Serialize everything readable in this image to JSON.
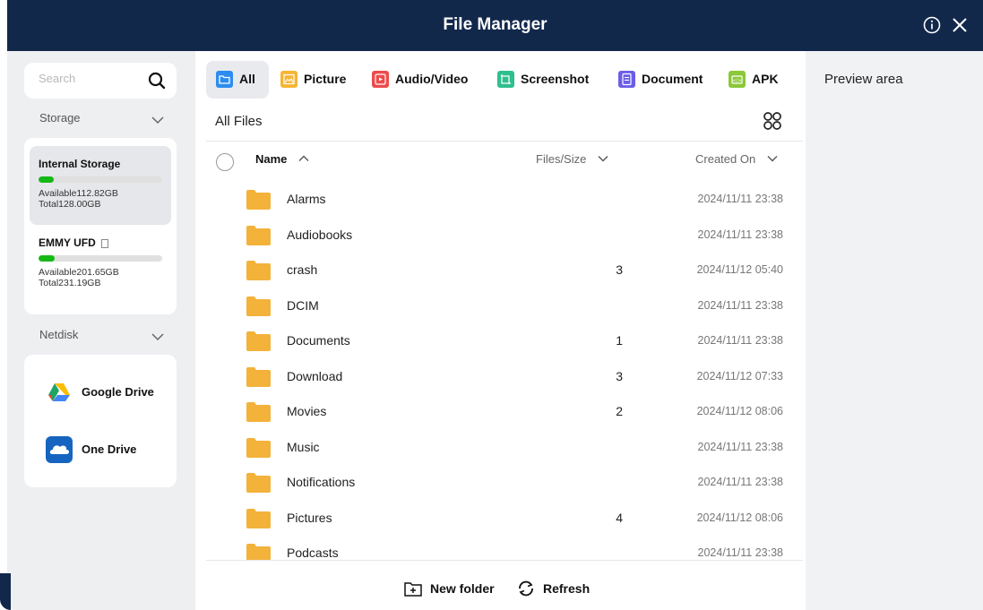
{
  "window": {
    "title": "File Manager",
    "info_icon": "info-icon",
    "close_icon": "close-icon"
  },
  "sidebar": {
    "search": {
      "placeholder": "Search",
      "value": "",
      "icon": "search-icon"
    },
    "storage_label": "Storage",
    "storage_items": [
      {
        "name": "Internal Storage",
        "available": "Available112.82GB",
        "total": "Total128.00GB",
        "used_fraction": 0.12,
        "selected": true
      },
      {
        "name": "EMMY UFD",
        "available": "Available201.65GB",
        "total": "Total231.19GB",
        "used_fraction": 0.13,
        "selected": false
      }
    ],
    "netdisk_label": "Netdisk",
    "netdisk_items": [
      {
        "label": "Google Drive",
        "icon": "google-drive-icon"
      },
      {
        "label": "One Drive",
        "icon": "onedrive-icon"
      }
    ]
  },
  "tabs": [
    {
      "label": "All",
      "icon": "folder-tab-icon",
      "color": "#2d8cf0",
      "active": true
    },
    {
      "label": "Picture",
      "icon": "picture-tab-icon",
      "color": "#f6b533",
      "active": false
    },
    {
      "label": "Audio/Video",
      "icon": "audio-video-tab-icon",
      "color": "#ee4b4b",
      "active": false
    },
    {
      "label": "Screenshot",
      "icon": "screenshot-tab-icon",
      "color": "#2fbf8f",
      "active": false
    },
    {
      "label": "Document",
      "icon": "document-tab-icon",
      "color": "#6b5de8",
      "active": false
    },
    {
      "label": "APK",
      "icon": "apk-tab-icon",
      "color": "#8bc83a",
      "active": false
    }
  ],
  "main": {
    "heading": "All Files",
    "view_icon": "grid-view-icon",
    "columns": {
      "name": "Name",
      "size": "Files/Size",
      "created": "Created On"
    },
    "files": [
      {
        "name": "Alarms",
        "count": "",
        "created": "2024/11/11 23:38"
      },
      {
        "name": "Audiobooks",
        "count": "",
        "created": "2024/11/11 23:38"
      },
      {
        "name": "crash",
        "count": "3",
        "created": "2024/11/12 05:40"
      },
      {
        "name": "DCIM",
        "count": "",
        "created": "2024/11/11 23:38"
      },
      {
        "name": "Documents",
        "count": "1",
        "created": "2024/11/11 23:38"
      },
      {
        "name": "Download",
        "count": "3",
        "created": "2024/11/12 07:33"
      },
      {
        "name": "Movies",
        "count": "2",
        "created": "2024/11/12 08:06"
      },
      {
        "name": "Music",
        "count": "",
        "created": "2024/11/11 23:38"
      },
      {
        "name": "Notifications",
        "count": "",
        "created": "2024/11/11 23:38"
      },
      {
        "name": "Pictures",
        "count": "4",
        "created": "2024/11/12 08:06"
      },
      {
        "name": "Podcasts",
        "count": "",
        "created": "2024/11/11 23:38"
      }
    ],
    "new_folder_label": "New folder",
    "refresh_label": "Refresh"
  },
  "preview": {
    "label": "Preview area"
  },
  "colors": {
    "titlebar": "#12284b",
    "folder": "#f3b23a",
    "storage_fill": "#16b816"
  }
}
